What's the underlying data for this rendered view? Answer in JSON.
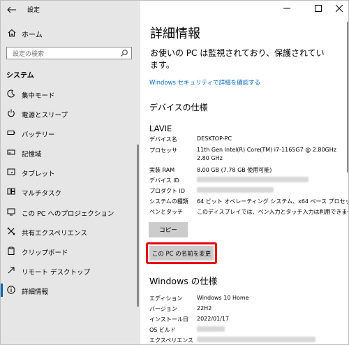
{
  "titlebar": {
    "back_label": "←",
    "app_title": "設定"
  },
  "sidebar": {
    "home_label": "ホーム",
    "search_placeholder": "設定の検索",
    "section_label": "システム",
    "items": [
      {
        "label": "集中モード",
        "icon": "moon-icon"
      },
      {
        "label": "電源とスリープ",
        "icon": "power-icon"
      },
      {
        "label": "バッテリー",
        "icon": "battery-icon"
      },
      {
        "label": "記憶域",
        "icon": "storage-icon"
      },
      {
        "label": "タブレット",
        "icon": "tablet-icon"
      },
      {
        "label": "マルチタスク",
        "icon": "multitask-icon"
      },
      {
        "label": "この PC へのプロジェクション",
        "icon": "projection-icon"
      },
      {
        "label": "共有エクスペリエンス",
        "icon": "shared-icon"
      },
      {
        "label": "クリップボード",
        "icon": "clipboard-icon"
      },
      {
        "label": "リモート デスクトップ",
        "icon": "remote-icon"
      },
      {
        "label": "詳細情報",
        "icon": "info-icon",
        "active": true
      }
    ]
  },
  "main": {
    "title": "詳細情報",
    "notice": "お使いの PC は監視されており、保護されています。",
    "security_link": "Windows セキュリティで詳細を確認する",
    "device_spec_heading": "デバイスの仕様",
    "brand": "LAVIE",
    "device_specs": [
      {
        "key": "デバイス名",
        "value": "DESKTOP-PC"
      },
      {
        "key": "プロセッサ",
        "value": "11th Gen Intel(R) Core(TM) i7-1165G7 @ 2.80GHz",
        "value2": "2.80 GHz"
      },
      {
        "key": "実装 RAM",
        "value": "8.00 GB (7.78 GB 使用可能)"
      },
      {
        "key": "デバイス ID",
        "value": ""
      },
      {
        "key": "プロダクト ID",
        "value": ""
      },
      {
        "key": "システムの種類",
        "value": "64 ビット オペレーティング システム、x64 ベース プロセッサ"
      },
      {
        "key": "ペンとタッチ",
        "value": "このディスプレイでは、ペン入力とタッチ入力は利用できません"
      }
    ],
    "copy_label": "コピー",
    "rename_label": "この PC の名前を変更",
    "windows_spec_heading": "Windows の仕様",
    "windows_specs": [
      {
        "key": "エディション",
        "value": "Windows 10 Home"
      },
      {
        "key": "バージョン",
        "value": "22H2"
      },
      {
        "key": "インストール日",
        "value": "2022/01/17"
      },
      {
        "key": "OS ビルド",
        "value": ""
      },
      {
        "key": "エクスペリエンス",
        "value": ""
      }
    ]
  }
}
